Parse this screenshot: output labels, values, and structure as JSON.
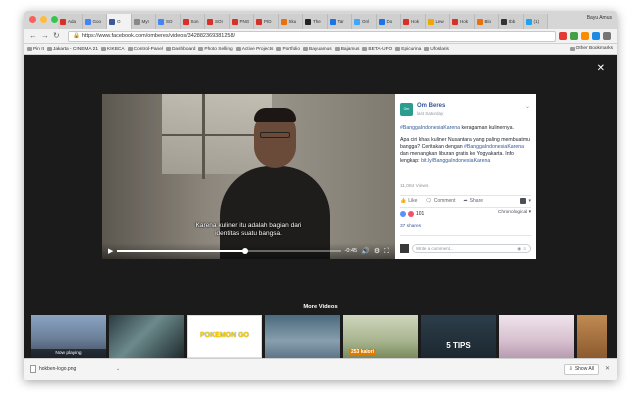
{
  "browser": {
    "profile_name": "Bayu Amus",
    "tabs": [
      {
        "label": "Ada",
        "color": "#d93025",
        "active": false
      },
      {
        "label": "Goo",
        "color": "#4285f4",
        "active": false
      },
      {
        "label": "O",
        "color": "#3b5998",
        "active": true
      },
      {
        "label": "MyI",
        "color": "#888888",
        "active": false
      },
      {
        "label": "SO",
        "color": "#4285f4",
        "active": false
      },
      {
        "label": "Son",
        "color": "#d93025",
        "active": false
      },
      {
        "label": "SOI",
        "color": "#d93025",
        "active": false
      },
      {
        "label": "PNG",
        "color": "#d93025",
        "active": false
      },
      {
        "label": "PID",
        "color": "#d93025",
        "active": false
      },
      {
        "label": "Sku",
        "color": "#e8710a",
        "active": false
      },
      {
        "label": "The",
        "color": "#222222",
        "active": false
      },
      {
        "label": "Tar",
        "color": "#1a73e8",
        "active": false
      },
      {
        "label": "Onl",
        "color": "#3ea6ff",
        "active": false
      },
      {
        "label": "Do",
        "color": "#1a73e8",
        "active": false
      },
      {
        "label": "Hok",
        "color": "#d93025",
        "active": false
      },
      {
        "label": "Lew",
        "color": "#f2a600",
        "active": false
      },
      {
        "label": "Hok",
        "color": "#d93025",
        "active": false
      },
      {
        "label": "Blo",
        "color": "#e8710a",
        "active": false
      },
      {
        "label": "tbb",
        "color": "#333333",
        "active": false
      },
      {
        "label": "(1)",
        "color": "#1da1f2",
        "active": false
      }
    ],
    "url": "https://www.facebook.com/omberes/videos/342882369381258/",
    "bookmarks": [
      "Pin It",
      "Jakarta - CINEMA 21",
      "KIKBCA",
      "Control-Panel",
      "Dashboard",
      "Photo Selling",
      "Active Projects",
      "Portfolio",
      "Bayuamus",
      "Bajamus",
      "BETA-UFO",
      "Epicurina",
      "Ufoslaris"
    ],
    "other_bookmarks": "Other Bookmarks"
  },
  "video": {
    "subtitle_line1": "Karena kuliner itu adalah bagian dari",
    "subtitle_line2": "identitas suatu bangsa.",
    "time_remaining": "-0:45",
    "progress": 0.57
  },
  "post": {
    "page_avatar_text": "Om Beres",
    "page_name": "Om Beres",
    "date": "last Saturday",
    "line1_hashtag": "#BanggaIndonesiaKarena",
    "line1_rest": " keragaman kulinernya.",
    "para2": "Apa ciri khas kuliner Nusantara yang paling membuatmu bangga? Ceritakan dengan",
    "para2_hashtag": "#BanggaIndonesiaKarena",
    "para2_rest": " dan menangkan liburan gratis ke Yogyakarta. Info lengkap:",
    "link": "bit.ly/BanggaIndonesiaKarena",
    "views": "11,084 Views",
    "like": "Like",
    "comment": "Comment",
    "share": "Share",
    "reaction_count": "101",
    "sort": "Chronological",
    "shares": "37 shares",
    "comment_placeholder": "Write a comment..."
  },
  "more_videos": {
    "title": "More Videos",
    "items": [
      {
        "caption": "Now playing",
        "text": ""
      },
      {
        "caption": "",
        "text": ""
      },
      {
        "caption": "",
        "text": "POKEMON GO"
      },
      {
        "caption": "",
        "text": ""
      },
      {
        "caption": "",
        "text": "253 kalori"
      },
      {
        "caption": "",
        "text": "5 TIPS"
      },
      {
        "caption": "",
        "text": ""
      },
      {
        "caption": "",
        "text": ""
      }
    ]
  },
  "downloads": {
    "file": "hokben-logo.png",
    "show_all": "Show All"
  }
}
